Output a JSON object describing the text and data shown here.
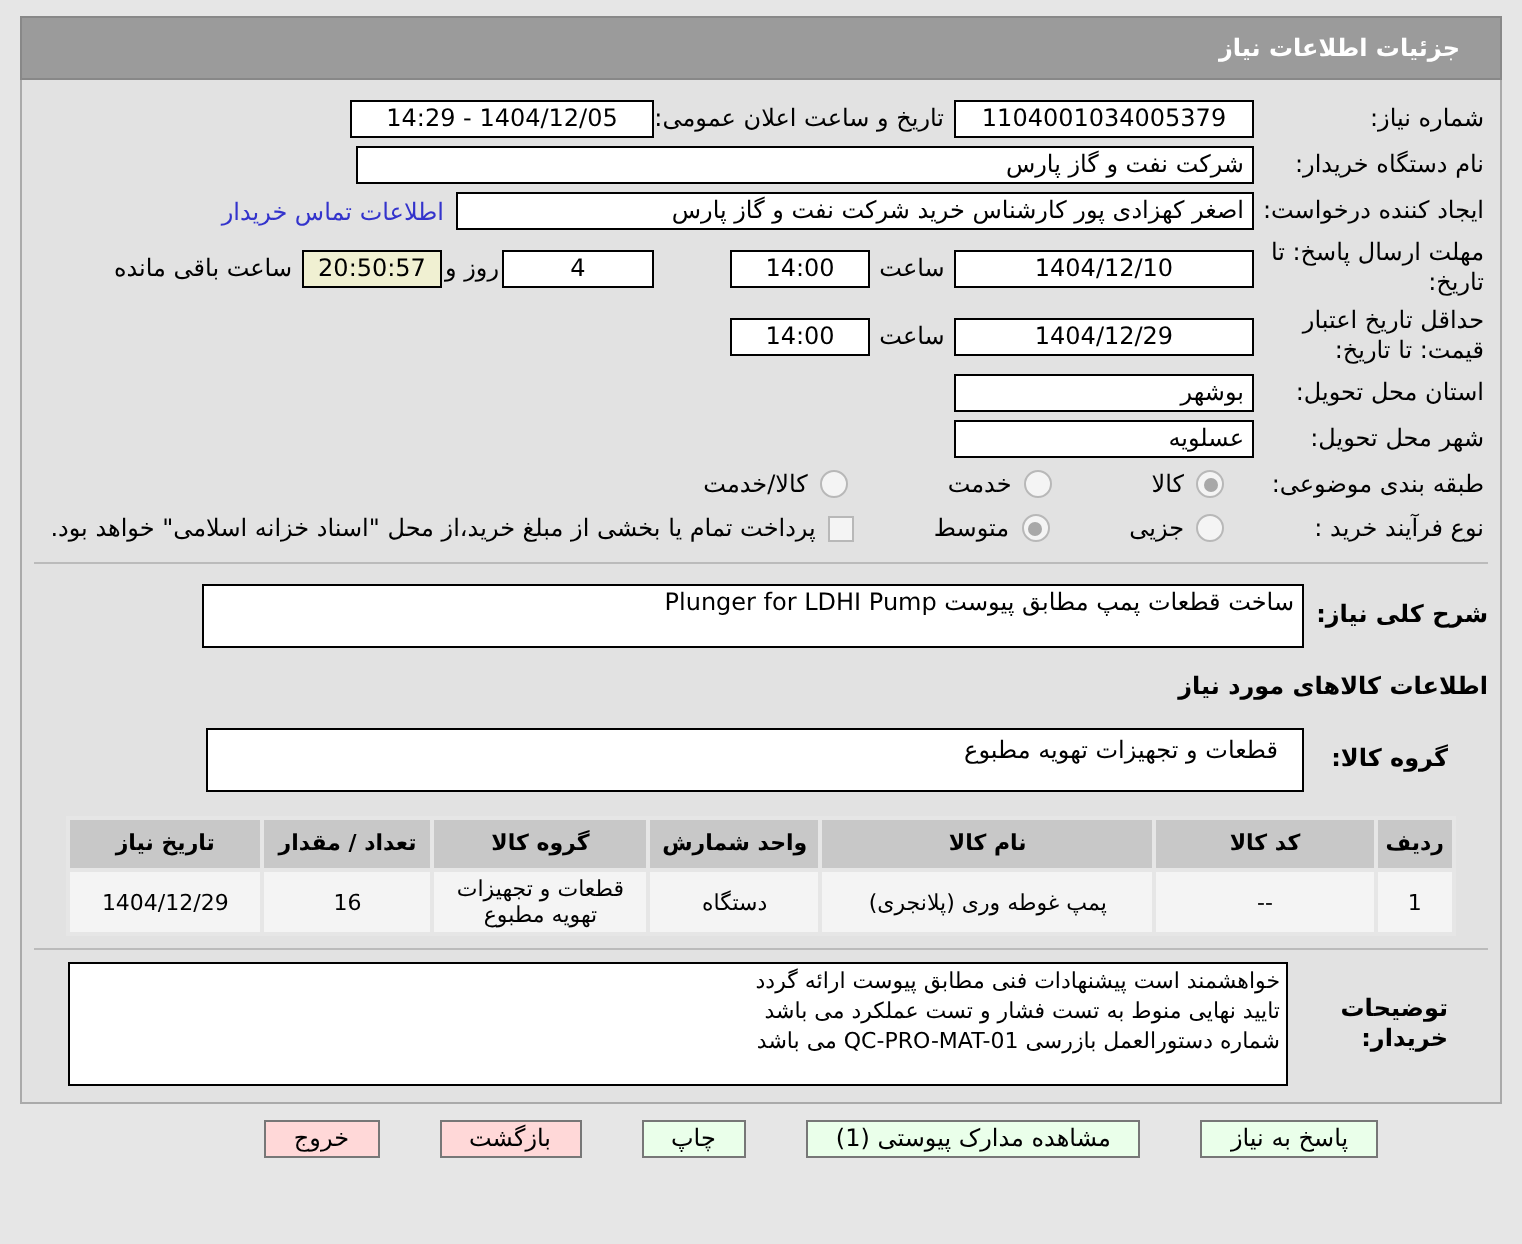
{
  "header": {
    "title": "جزئیات اطلاعات نیاز"
  },
  "need_number": {
    "label": "شماره نیاز:",
    "value": "1104001034005379"
  },
  "announce": {
    "label": "تاریخ و ساعت اعلان عمومی:",
    "value": "1404/12/05 - 14:29"
  },
  "buyer": {
    "label": "نام دستگاه خریدار:",
    "value": "شرکت نفت و گاز پارس"
  },
  "creator": {
    "label": "ایجاد کننده درخواست:",
    "value": "اصغر کهزادی پور کارشناس خرید شرکت نفت و گاز پارس",
    "link": "اطلاعات تماس خریدار"
  },
  "deadline": {
    "label": "مهلت ارسال پاسخ: تا تاریخ:",
    "date": "1404/12/10",
    "time_label": "ساعت",
    "time": "14:00",
    "days": "4",
    "days_suffix": "روز و",
    "remaining": "20:50:57",
    "remaining_label": "ساعت باقی مانده"
  },
  "validity": {
    "label": "حداقل تاریخ اعتبار قیمت: تا تاریخ:",
    "date": "1404/12/29",
    "time_label": "ساعت",
    "time": "14:00"
  },
  "province": {
    "label": "استان محل تحویل:",
    "value": "بوشهر"
  },
  "city": {
    "label": "شهر محل تحویل:",
    "value": "عسلویه"
  },
  "category": {
    "label": "طبقه بندی موضوعی:",
    "options": [
      {
        "label": "کالا",
        "selected": true
      },
      {
        "label": "خدمت",
        "selected": false
      },
      {
        "label": "کالا/خدمت",
        "selected": false
      }
    ]
  },
  "purchase_type": {
    "label": "نوع فرآیند خرید :",
    "options": [
      {
        "label": "جزیی",
        "selected": false
      },
      {
        "label": "متوسط",
        "selected": true
      }
    ],
    "checkbox": {
      "label": "پرداخت تمام یا بخشی از مبلغ خرید،از محل \"اسناد خزانه اسلامی\" خواهد بود.",
      "checked": false
    }
  },
  "summary": {
    "label": "شرح کلی نیاز:",
    "value": "ساخت قطعات پمپ مطابق پیوست Plunger for LDHI Pump"
  },
  "goods_title": "اطلاعات کالاهای مورد نیاز",
  "goods_group": {
    "label": "گروه کالا:",
    "value": "قطعات و تجهیزات تهویه مطبوع"
  },
  "table": {
    "columns": [
      "ردیف",
      "کد کالا",
      "نام کالا",
      "واحد شمارش",
      "گروه کالا",
      "تعداد / مقدار",
      "تاریخ نیاز"
    ],
    "rows": [
      [
        "1",
        "--",
        "پمپ غوطه وری (پلانجری)",
        "دستگاه",
        "قطعات و تجهیزات تهویه مطبوع",
        "16",
        "1404/12/29"
      ]
    ]
  },
  "buyer_notes": {
    "label": "توضیحات خریدار:",
    "lines": [
      "خواهشمند است پیشنهادات فنی مطابق پیوست ارائه گردد",
      "تایید نهایی منوط به تست فشار و تست عملکرد می باشد",
      "شماره دستورالعمل بازرسی QC-PRO-MAT-01 می باشد"
    ]
  },
  "buttons": [
    {
      "label": "پاسخ به نیاز",
      "kind": "green"
    },
    {
      "label": "مشاهده مدارک پیوستی (1)",
      "kind": "green"
    },
    {
      "label": "چاپ",
      "kind": "green"
    },
    {
      "label": "بازگشت",
      "kind": "red"
    },
    {
      "label": "خروج",
      "kind": "red"
    }
  ]
}
